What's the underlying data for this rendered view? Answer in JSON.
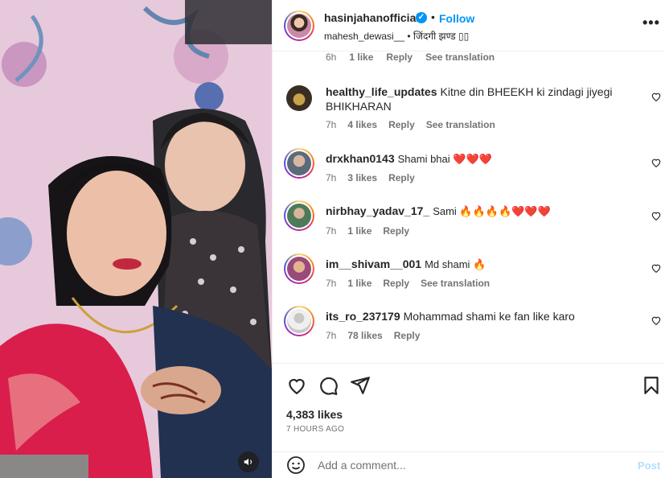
{
  "header": {
    "username": "hasinjahanofficial",
    "verified_mark": "✓",
    "separator": "•",
    "follow_label": "Follow",
    "audio_text": "mahesh_dewasi__ • जिंदगी झण्ड ▯▯",
    "more_label": "•••"
  },
  "partial_comment": {
    "meta": [
      "6h",
      "1 like",
      "Reply",
      "See translation"
    ]
  },
  "comments": [
    {
      "user": "healthy_life_updates",
      "text": "Kitne din BHEEKH ki zindagi jiyegi BHIKHARAN",
      "time": "7h",
      "likes": "4 likes",
      "reply": "Reply",
      "translation": "See translation"
    },
    {
      "user": "drxkhan0143",
      "text": "Shami bhai ❤️❤️❤️",
      "time": "7h",
      "likes": "3 likes",
      "reply": "Reply"
    },
    {
      "user": "nirbhay_yadav_17_",
      "text": "Sami 🔥🔥🔥🔥❤️❤️❤️",
      "time": "7h",
      "likes": "1 like",
      "reply": "Reply"
    },
    {
      "user": "im__shivam__001",
      "text": "Md shami 🔥",
      "time": "7h",
      "likes": "1 like",
      "reply": "Reply",
      "translation": "See translation"
    },
    {
      "user": "its_ro_237179",
      "text": "Mohammad shami ke fan like karo",
      "time": "7h",
      "likes": "78 likes",
      "reply": "Reply"
    }
  ],
  "post": {
    "likes": "4,383 likes",
    "timestamp": "7 HOURS AGO"
  },
  "composer": {
    "placeholder": "Add a comment...",
    "post_label": "Post"
  },
  "icons": {
    "like": "heart-icon",
    "comment": "comment-icon",
    "share": "share-icon",
    "save": "bookmark-icon",
    "emoji": "emoji-icon",
    "mute": "speaker-icon"
  },
  "colors": {
    "accent": "#0095f6",
    "muted": "#737373",
    "post_disabled": "#b2dffc",
    "heart": "#e0245e"
  }
}
